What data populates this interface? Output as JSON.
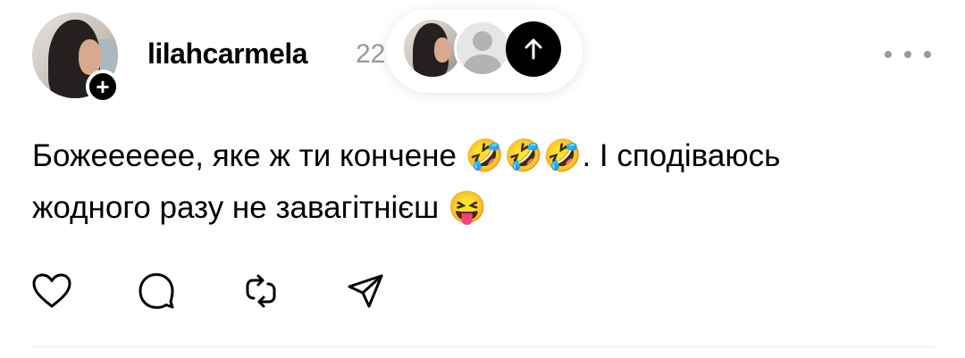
{
  "post": {
    "username": "lilahcarmela",
    "timestamp": "22",
    "text_line1": "Божееееее, яке ж ти кончене 🤣🤣🤣. І сподіваюсь",
    "text_line2": "жодного разу не завагітнієш 😝"
  },
  "avatar": {
    "follow_badge": "+"
  },
  "overlay": {
    "icons": [
      "user-avatar",
      "generic-user-avatar",
      "arrow-up-icon"
    ]
  },
  "actions": {
    "icons": [
      "heart-icon",
      "comment-icon",
      "repost-icon",
      "share-icon"
    ]
  },
  "colors": {
    "text": "#000000",
    "muted": "#9a9a9a",
    "badge": "#000000",
    "divider": "#e8e8e8"
  }
}
